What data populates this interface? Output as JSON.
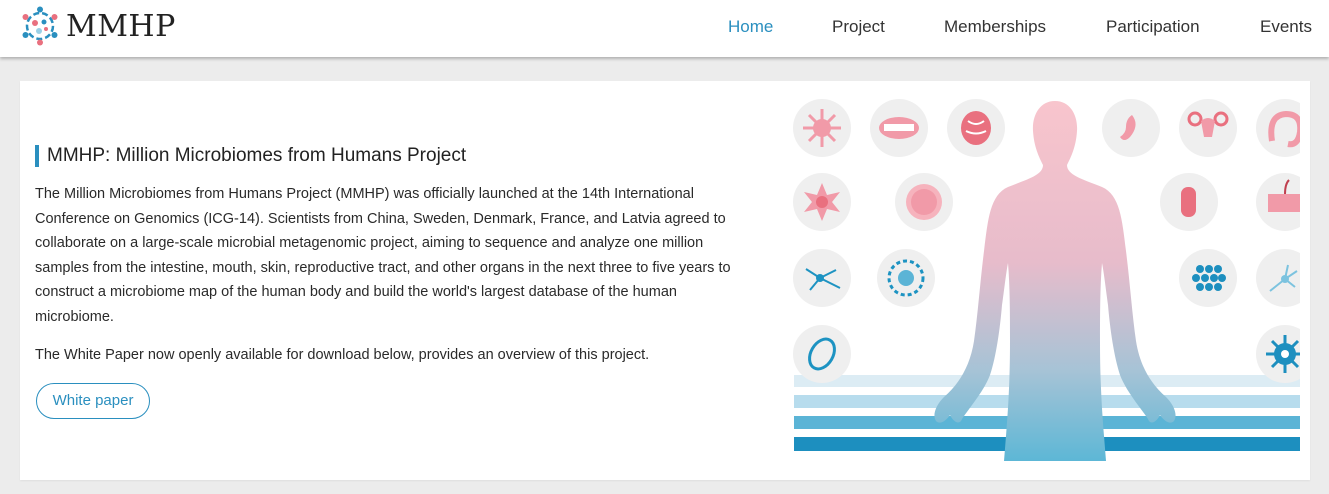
{
  "header": {
    "brand": "MMHP",
    "nav": [
      {
        "label": "Home",
        "active": true
      },
      {
        "label": "Project",
        "active": false
      },
      {
        "label": "Memberships",
        "active": false
      },
      {
        "label": "Participation",
        "active": false
      },
      {
        "label": "Events",
        "active": false
      }
    ]
  },
  "hero": {
    "title": "MMHP: Million Microbiomes from Humans Project",
    "description": "The Million Microbiomes from Humans Project (MMHP) was officially launched at the 14th International Conference on Genomics (ICG-14). Scientists from China, Sweden, Denmark, France, and Latvia agreed to collaborate on a large-scale microbial metagenomic project, aiming to sequence and analyze one million samples from the intestine, mouth, skin, reproductive tract, and other organs in the next three to five years to construct a microbiome map of the human body and build the world's largest database of the human microbiome.",
    "note": "The White Paper now openly available for download below, provides an overview of this project.",
    "button_label": "White paper"
  },
  "colors": {
    "accent": "#2a8fbf",
    "organ_pink": "#f19aa8",
    "microbe_blue": "#1d93c2",
    "circle_bg": "#efefef"
  },
  "illustration": {
    "icons": [
      "microbe-icon",
      "mouth-icon",
      "brain-icon",
      "stomach-icon",
      "uterus-icon",
      "intestine-icon",
      "cell-icon",
      "egg-cell-icon",
      "bacterium-icon",
      "skin-icon",
      "neuron-icon",
      "gut-flora-icon",
      "cell-cluster-icon",
      "neuron-icon",
      "bacterium-oval-icon",
      "virus-icon"
    ],
    "figure": "human-body-icon",
    "crowd": "people-crowd-icon"
  }
}
